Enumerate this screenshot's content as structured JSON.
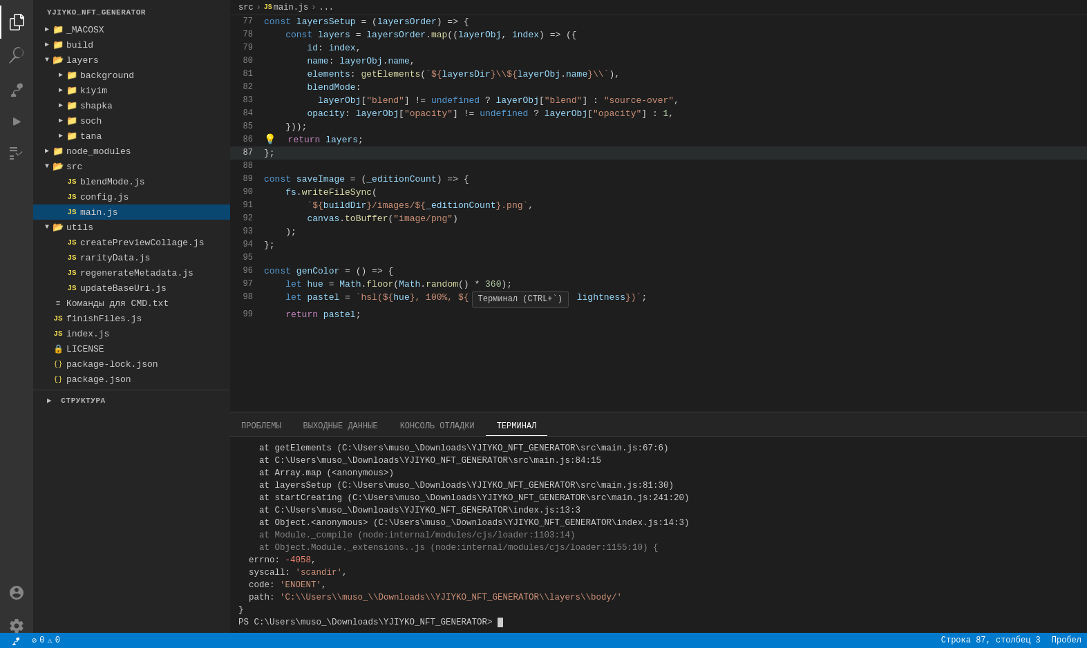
{
  "app": {
    "title": "YJIYKO_NFT_GENERATOR",
    "status_bar": {
      "errors": "0",
      "warnings": "0",
      "line": "Строка 87, столбец 3",
      "encoding": "Пробел"
    }
  },
  "sidebar": {
    "title": "YJIYKO_NFT_GENERATOR",
    "items": [
      {
        "id": "MACOSX",
        "label": "_MACOSX",
        "type": "folder",
        "collapsed": true,
        "indent": 1
      },
      {
        "id": "build",
        "label": "build",
        "type": "folder",
        "collapsed": true,
        "indent": 1
      },
      {
        "id": "layers",
        "label": "layers",
        "type": "folder",
        "collapsed": false,
        "indent": 1
      },
      {
        "id": "background",
        "label": "background",
        "type": "folder",
        "collapsed": true,
        "indent": 2
      },
      {
        "id": "kiyim",
        "label": "kiyim",
        "type": "folder",
        "collapsed": true,
        "indent": 2
      },
      {
        "id": "shapka",
        "label": "shapka",
        "type": "folder",
        "collapsed": true,
        "indent": 2
      },
      {
        "id": "soch",
        "label": "soch",
        "type": "folder",
        "collapsed": true,
        "indent": 2
      },
      {
        "id": "tana",
        "label": "tana",
        "type": "folder",
        "collapsed": true,
        "indent": 2
      },
      {
        "id": "node_modules",
        "label": "node_modules",
        "type": "folder",
        "collapsed": true,
        "indent": 1
      },
      {
        "id": "src",
        "label": "src",
        "type": "folder",
        "collapsed": false,
        "indent": 1
      },
      {
        "id": "blendMode",
        "label": "blendMode.js",
        "type": "js",
        "indent": 2
      },
      {
        "id": "config",
        "label": "config.js",
        "type": "js",
        "indent": 2
      },
      {
        "id": "main",
        "label": "main.js",
        "type": "js",
        "indent": 2,
        "selected": true
      },
      {
        "id": "utils",
        "label": "utils",
        "type": "folder",
        "collapsed": false,
        "indent": 1
      },
      {
        "id": "createPreviewCollage",
        "label": "createPreviewCollage.js",
        "type": "js",
        "indent": 2
      },
      {
        "id": "rarityData",
        "label": "rarityData.js",
        "type": "js",
        "indent": 2
      },
      {
        "id": "regenerateMetadata",
        "label": "regenerateMetadata.js",
        "type": "js",
        "indent": 2
      },
      {
        "id": "updateBaseUri",
        "label": "updateBaseUri.js",
        "type": "js",
        "indent": 2
      },
      {
        "id": "commands",
        "label": "Команды для CMD.txt",
        "type": "txt",
        "indent": 1
      },
      {
        "id": "finishFiles",
        "label": "finishFiles.js",
        "type": "js",
        "indent": 1
      },
      {
        "id": "index",
        "label": "index.js",
        "type": "js",
        "indent": 1
      },
      {
        "id": "LICENSE",
        "label": "LICENSE",
        "type": "lock",
        "indent": 1
      },
      {
        "id": "package-lock",
        "label": "package-lock.json",
        "type": "json",
        "indent": 1
      },
      {
        "id": "package",
        "label": "package.json",
        "type": "json",
        "indent": 1
      }
    ],
    "section_bottom": "СТРУКТУРА"
  },
  "breadcrumb": {
    "parts": [
      "src",
      "JS main.js",
      "..."
    ]
  },
  "editor": {
    "lines": [
      {
        "num": 77,
        "content": "const layersSetup = (layersOrder) => {"
      },
      {
        "num": 78,
        "content": "  const layers = layersOrder.map((layerObj, index) => ({"
      },
      {
        "num": 79,
        "content": "    id: index,"
      },
      {
        "num": 80,
        "content": "    name: layerObj.name,"
      },
      {
        "num": 81,
        "content": "    elements: getElements(`${layersDir}\\\\${layerObj.name}\\\\`),"
      },
      {
        "num": 82,
        "content": "    blendMode:"
      },
      {
        "num": 83,
        "content": "      layerObj[\"blend\"] != undefined ? layerObj[\"blend\"] : \"source-over\","
      },
      {
        "num": 84,
        "content": "    opacity: layerObj[\"opacity\"] != undefined ? layerObj[\"opacity\"] : 1,"
      },
      {
        "num": 85,
        "content": "  }));"
      },
      {
        "num": 86,
        "content": "  return layers;",
        "has_lightbulb": true
      },
      {
        "num": 87,
        "content": "};"
      },
      {
        "num": 88,
        "content": ""
      },
      {
        "num": 89,
        "content": "const saveImage = (_editionCount) => {"
      },
      {
        "num": 90,
        "content": "  fs.writeFileSync("
      },
      {
        "num": 91,
        "content": "    `${buildDir}/images/${_editionCount}.png`,"
      },
      {
        "num": 92,
        "content": "    canvas.toBuffer(\"image/png\")"
      },
      {
        "num": 93,
        "content": "  );"
      },
      {
        "num": 94,
        "content": "};"
      },
      {
        "num": 95,
        "content": ""
      },
      {
        "num": 96,
        "content": "const genColor = () => {"
      },
      {
        "num": 97,
        "content": "  let hue = Math.floor(Math.random() * 360);"
      },
      {
        "num": 98,
        "content": "  let pastel = `hsl(${hue}, 100%, ${",
        "tooltip": "Терминал (CTRL+`)"
      },
      {
        "num": 99,
        "content": "  return pastel;"
      }
    ]
  },
  "terminal": {
    "tabs": [
      {
        "id": "problems",
        "label": "ПРОБЛЕМЫ"
      },
      {
        "id": "output",
        "label": "ВЫХОДНЫЕ ДАННЫЕ"
      },
      {
        "id": "debug",
        "label": "КОНСОЛЬ ОТЛАДКИ"
      },
      {
        "id": "terminal",
        "label": "ТЕРМИНАЛ",
        "active": true
      }
    ],
    "lines": [
      {
        "text": "    at getElements (C:\\Users\\muso_\\Downloads\\YJIYKO_NFT_GENERATOR\\src\\main.js:67:6)"
      },
      {
        "text": "    at C:\\Users\\muso_\\Downloads\\YJIYKO_NFT_GENERATOR\\src\\main.js:84:15"
      },
      {
        "text": "    at Array.map (<anonymous>)"
      },
      {
        "text": "    at layersSetup (C:\\Users\\muso_\\Downloads\\YJIYKO_NFT_GENERATOR\\src\\main.js:81:30)"
      },
      {
        "text": "    at startCreating (C:\\Users\\muso_\\Downloads\\YJIYKO_NFT_GENERATOR\\src\\main.js:241:20)"
      },
      {
        "text": "    at C:\\Users\\muso_\\Downloads\\YJIYKO_NFT_GENERATOR\\index.js:13:3"
      },
      {
        "text": "    at Object.<anonymous> (C:\\Users\\muso_\\Downloads\\YJIYKO_NFT_GENERATOR\\index.js:14:3)"
      },
      {
        "text": "    at Module._compile (node:internal/modules/cjs/loader:1103:14)",
        "dim": true
      },
      {
        "text": "    at Object.Module._extensions..js (node:internal/modules/cjs/loader:1155:10) {",
        "dim": true
      },
      {
        "text": "  errno: -4058,",
        "has_error_num": true,
        "errno_val": "-4058"
      },
      {
        "text": "  syscall: 'scandir',",
        "has_str": true,
        "str_val": "'scandir'"
      },
      {
        "text": "  code: 'ENOENT',",
        "has_str": true,
        "str_val": "'ENOENT'"
      },
      {
        "text": "  path: 'C:\\\\Users\\\\muso_\\\\Downloads\\\\YJIYKO_NFT_GENERATOR\\\\layers\\\\body/'",
        "has_path": true,
        "path_val": "'C:\\\\Users\\\\muso_\\\\Downloads\\\\YJIYKO_NFT_GENERATOR\\\\layers\\\\body/'"
      },
      {
        "text": "}"
      },
      {
        "text": "PS C:\\Users\\muso_\\Downloads\\YJIYKO_NFT_GENERATOR> ",
        "is_prompt": true
      }
    ]
  }
}
